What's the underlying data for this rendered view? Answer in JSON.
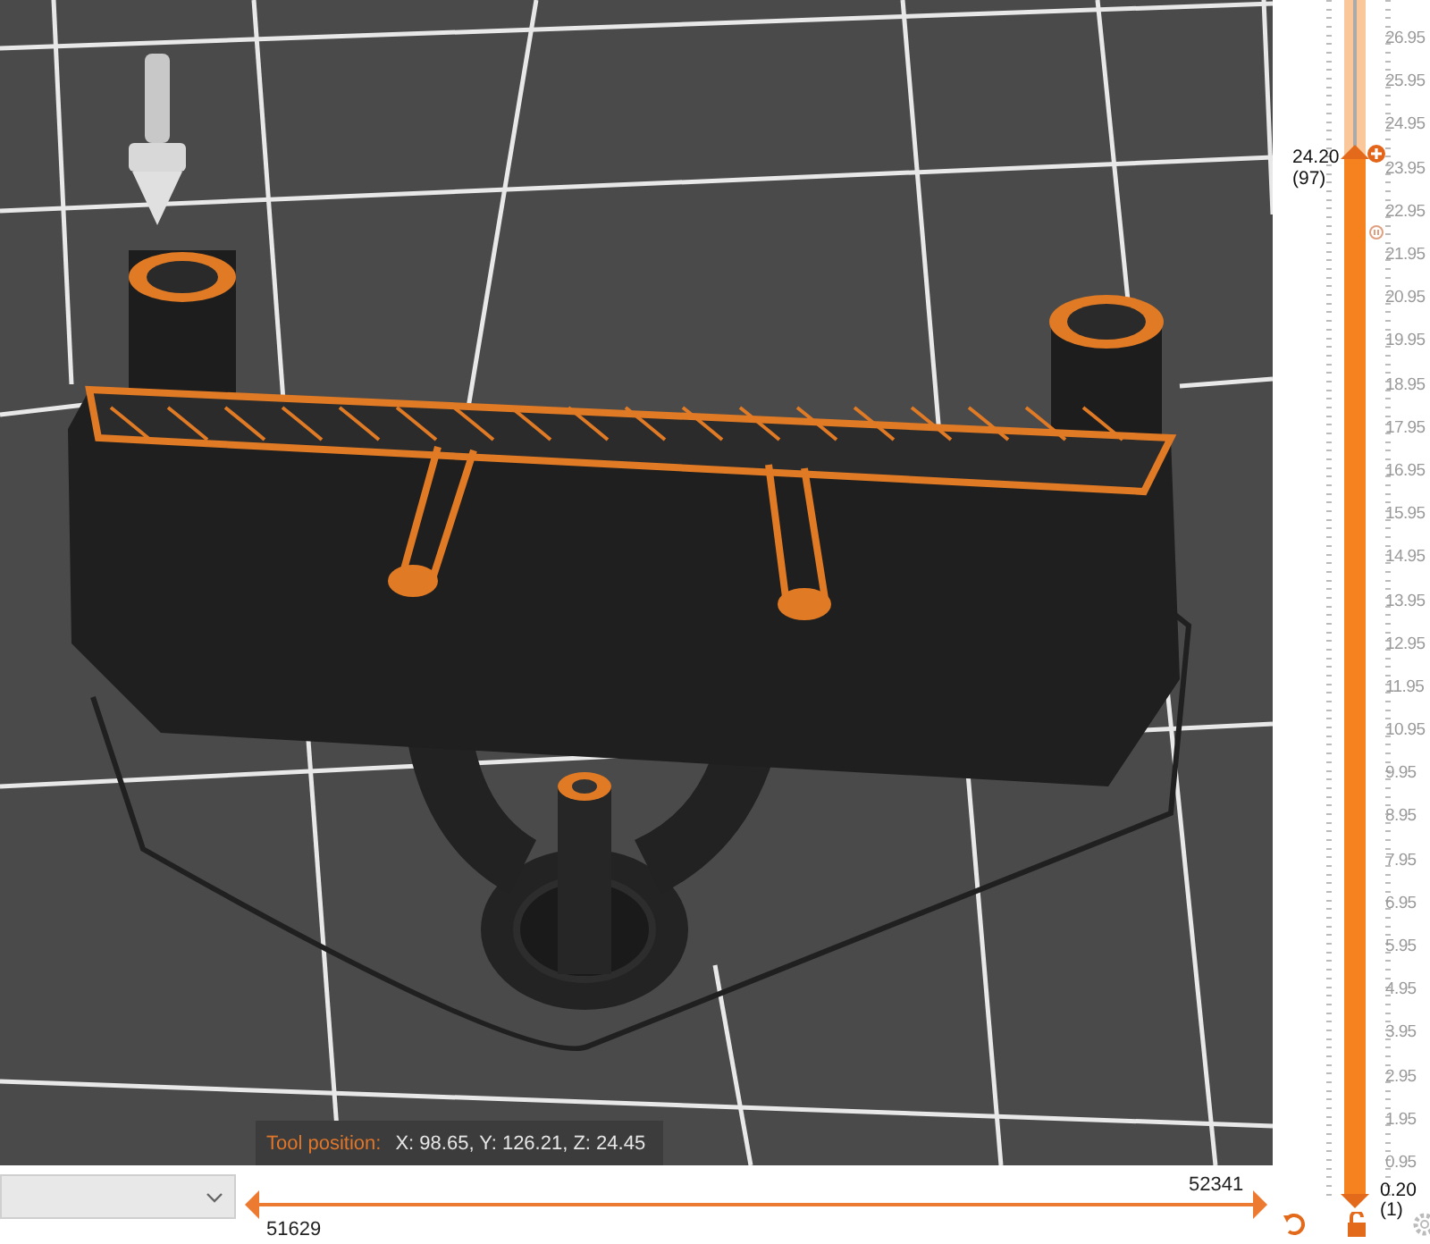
{
  "viewport": {
    "tool_position": {
      "label": "Tool position:",
      "value": "X: 98.65, Y: 126.21, Z: 24.45"
    }
  },
  "layer_slider": {
    "ticks": [
      "26.95",
      "25.95",
      "24.95",
      "23.95",
      "22.95",
      "21.95",
      "20.95",
      "19.95",
      "18.95",
      "17.95",
      "16.95",
      "15.95",
      "14.95",
      "13.95",
      "12.95",
      "11.95",
      "10.95",
      "9.95",
      "8.95",
      "7.95",
      "6.95",
      "5.95",
      "4.95",
      "3.95",
      "2.95",
      "1.95",
      "0.95"
    ],
    "upper": {
      "value": "24.20",
      "layer": "(97)",
      "level": 0.868
    },
    "lower": {
      "value": "0.20",
      "layer": "(1)",
      "level": 0
    }
  },
  "move_slider": {
    "lower": {
      "value": "51629",
      "level": 0
    },
    "upper": {
      "value": "52341",
      "level": 1
    }
  }
}
